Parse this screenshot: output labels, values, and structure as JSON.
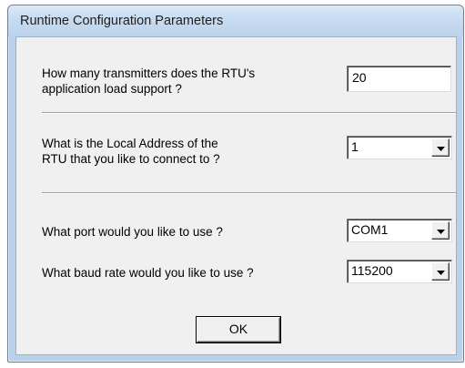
{
  "window": {
    "title": "Runtime Configuration Parameters"
  },
  "form": {
    "transmitters": {
      "label_line1": "How many transmitters does the RTU's",
      "label_line2": "application load support ?",
      "value": "20"
    },
    "local_address": {
      "label_line1": "What is the Local Address of the",
      "label_line2": "RTU that you like to connect to ?",
      "value": "1"
    },
    "port": {
      "label": "What port would you like to use ?",
      "value": "COM1"
    },
    "baud": {
      "label": "What baud rate would you like to use ?",
      "value": "115200"
    }
  },
  "buttons": {
    "ok_label": "OK"
  },
  "icons": {
    "dropdown": "chevron-down-icon"
  }
}
